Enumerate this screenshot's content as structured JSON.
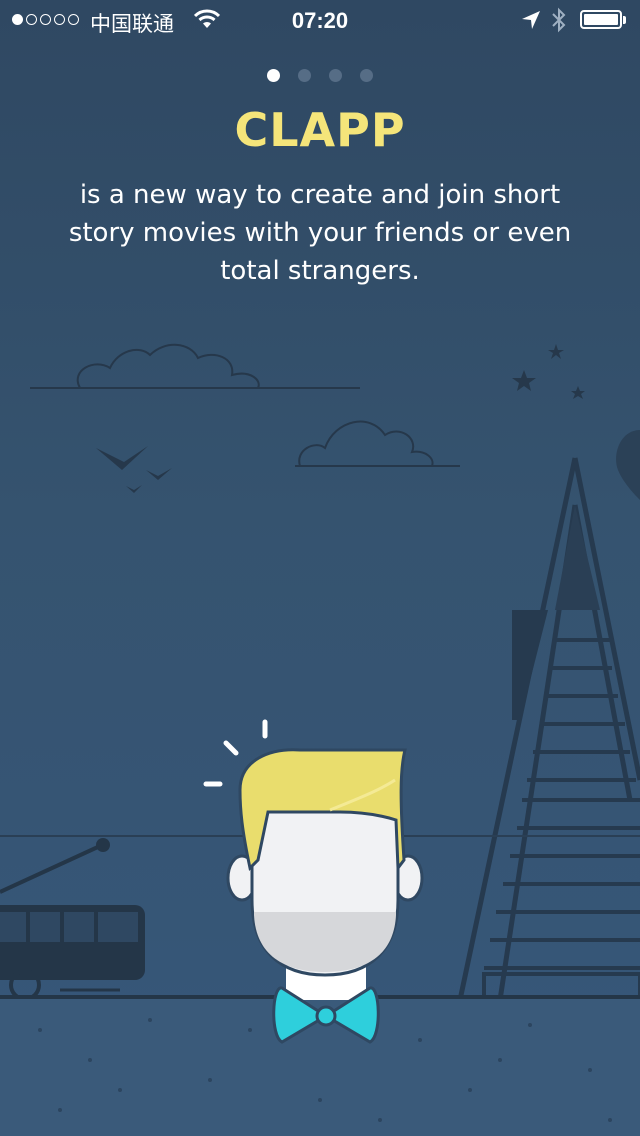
{
  "status_bar": {
    "signal_dots_filled": 1,
    "signal_dots_total": 5,
    "carrier": "中国联通",
    "time": "07:20",
    "battery_level": 1.0
  },
  "pager": {
    "total": 4,
    "active_index": 0
  },
  "onboarding": {
    "title": "CLAPP",
    "description": "is a new way to create and join short story movies with your friends or even total strangers."
  },
  "colors": {
    "title": "#f5e57a",
    "background_top": "#2f4862",
    "background_bottom": "#37577a",
    "hair": "#e9dd6d",
    "bow_tie": "#2ecfdc"
  },
  "icons": {
    "wifi": "wifi-icon",
    "location": "location-arrow-icon",
    "bluetooth": "bluetooth-icon",
    "battery": "battery-icon"
  }
}
